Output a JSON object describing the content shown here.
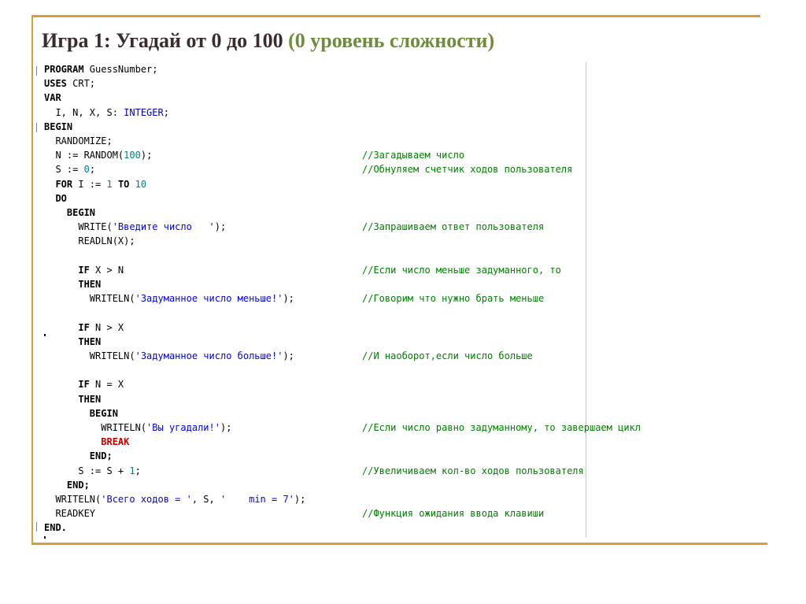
{
  "title": {
    "main": "Игра 1: Угадай от 0 до 100",
    "sub": "(0 уровень сложности)"
  },
  "code": [
    {
      "segments": [
        {
          "t": "PROGRAM",
          "c": "kw"
        },
        {
          "t": " GuessNumber;",
          "c": ""
        }
      ],
      "comment": ""
    },
    {
      "segments": [
        {
          "t": "USES",
          "c": "kw"
        },
        {
          "t": " CRT;",
          "c": ""
        }
      ],
      "comment": ""
    },
    {
      "segments": [
        {
          "t": "VAR",
          "c": "kw"
        }
      ],
      "comment": ""
    },
    {
      "segments": [
        {
          "t": "  I, N, X, S: ",
          "c": ""
        },
        {
          "t": "INTEGER",
          "c": "typ"
        },
        {
          "t": ";",
          "c": ""
        }
      ],
      "comment": ""
    },
    {
      "segments": [
        {
          "t": "BEGIN",
          "c": "kw"
        }
      ],
      "comment": ""
    },
    {
      "segments": [
        {
          "t": "  RANDOMIZE;",
          "c": ""
        }
      ],
      "comment": ""
    },
    {
      "segments": [
        {
          "t": "  N := RANDOM(",
          "c": ""
        },
        {
          "t": "100",
          "c": "num"
        },
        {
          "t": ");",
          "c": ""
        }
      ],
      "comment": "//Загадываем число"
    },
    {
      "segments": [
        {
          "t": "  S := ",
          "c": ""
        },
        {
          "t": "0",
          "c": "num"
        },
        {
          "t": ";",
          "c": ""
        }
      ],
      "comment": "//Обнуляем счетчик ходов пользователя"
    },
    {
      "segments": [
        {
          "t": "  FOR",
          "c": "kw"
        },
        {
          "t": " I := ",
          "c": ""
        },
        {
          "t": "1",
          "c": "num"
        },
        {
          "t": " TO ",
          "c": "kw"
        },
        {
          "t": "10",
          "c": "num"
        }
      ],
      "comment": ""
    },
    {
      "segments": [
        {
          "t": "  DO",
          "c": "kw"
        }
      ],
      "comment": ""
    },
    {
      "segments": [
        {
          "t": "    BEGIN",
          "c": "kw"
        }
      ],
      "comment": ""
    },
    {
      "segments": [
        {
          "t": "      WRITE(",
          "c": ""
        },
        {
          "t": "'Введите число   '",
          "c": "str"
        },
        {
          "t": ");",
          "c": ""
        }
      ],
      "comment": "//Запрашиваем ответ пользователя"
    },
    {
      "segments": [
        {
          "t": "      READLN(X);",
          "c": ""
        }
      ],
      "comment": ""
    },
    {
      "segments": [],
      "comment": ""
    },
    {
      "segments": [
        {
          "t": "      IF",
          "c": "kw"
        },
        {
          "t": " X > N",
          "c": ""
        }
      ],
      "comment": "//Если число меньше задуманного, то"
    },
    {
      "segments": [
        {
          "t": "      THEN",
          "c": "kw"
        }
      ],
      "comment": ""
    },
    {
      "segments": [
        {
          "t": "        WRITELN(",
          "c": ""
        },
        {
          "t": "'Задуманное число меньше!'",
          "c": "str"
        },
        {
          "t": ");",
          "c": ""
        }
      ],
      "comment": "//Говорим что нужно брать меньше"
    },
    {
      "segments": [],
      "comment": ""
    },
    {
      "segments": [
        {
          "t": "      IF",
          "c": "kw"
        },
        {
          "t": " N > X",
          "c": ""
        }
      ],
      "comment": ""
    },
    {
      "segments": [
        {
          "t": "      THEN",
          "c": "kw"
        }
      ],
      "comment": ""
    },
    {
      "segments": [
        {
          "t": "        WRITELN(",
          "c": ""
        },
        {
          "t": "'Задуманное число больше!'",
          "c": "str"
        },
        {
          "t": ");",
          "c": ""
        }
      ],
      "comment": "//И наоборот,если число больше"
    },
    {
      "segments": [],
      "comment": ""
    },
    {
      "segments": [
        {
          "t": "      IF",
          "c": "kw"
        },
        {
          "t": " N = X",
          "c": ""
        }
      ],
      "comment": ""
    },
    {
      "segments": [
        {
          "t": "      THEN",
          "c": "kw"
        }
      ],
      "comment": ""
    },
    {
      "segments": [
        {
          "t": "        BEGIN",
          "c": "kw"
        }
      ],
      "comment": ""
    },
    {
      "segments": [
        {
          "t": "          WRITELN(",
          "c": ""
        },
        {
          "t": "'Вы угадали!'",
          "c": "str"
        },
        {
          "t": ");",
          "c": ""
        }
      ],
      "comment": "//Если число равно задуманному, то завершаем цикл"
    },
    {
      "segments": [
        {
          "t": "          BREAK",
          "c": "red"
        }
      ],
      "comment": ""
    },
    {
      "segments": [
        {
          "t": "        END;",
          "c": "kw"
        }
      ],
      "comment": ""
    },
    {
      "segments": [
        {
          "t": "      S := S + ",
          "c": ""
        },
        {
          "t": "1",
          "c": "num"
        },
        {
          "t": ";",
          "c": ""
        }
      ],
      "comment": "//Увеличиваем кол-во ходов пользователя"
    },
    {
      "segments": [
        {
          "t": "    END;",
          "c": "kw"
        }
      ],
      "comment": ""
    },
    {
      "segments": [
        {
          "t": "  WRITELN(",
          "c": ""
        },
        {
          "t": "'Всего ходов = '",
          "c": "str"
        },
        {
          "t": ", S, ",
          "c": ""
        },
        {
          "t": "'    min = 7'",
          "c": "str"
        },
        {
          "t": ");",
          "c": ""
        }
      ],
      "comment": ""
    },
    {
      "segments": [
        {
          "t": "  READKEY",
          "c": ""
        }
      ],
      "comment": "//Функция ожидания ввода клавиши"
    },
    {
      "segments": [
        {
          "t": "END.",
          "c": "kw"
        }
      ],
      "comment": ""
    }
  ]
}
